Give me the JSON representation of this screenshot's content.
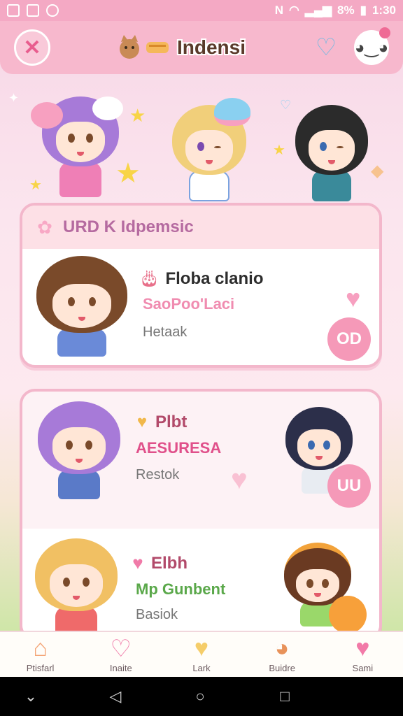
{
  "status_bar": {
    "battery": "8%",
    "time": "1:30"
  },
  "header": {
    "title": "Indensi",
    "close_icon": "close-icon",
    "heart_icon": "heart-outline-icon",
    "mascot_icon": "mascot-icon"
  },
  "featured_card": {
    "section_title": "URD K Idpemsic",
    "title": "Floba clanio",
    "subtitle": "SaoPoo'Laci",
    "meta": "Hetaak",
    "action_label": "OD"
  },
  "list": [
    {
      "title": "Plbt",
      "subtitle": "AESURESA",
      "meta": "Restok",
      "action_label": "UU"
    },
    {
      "title": "Elbh",
      "subtitle": "Mp Gunbent",
      "meta": "Basiok"
    }
  ],
  "bottom_nav": [
    {
      "label": "Ptisfarl",
      "icon": "home-icon"
    },
    {
      "label": "Inaite",
      "icon": "heart-badge-icon"
    },
    {
      "label": "Lark",
      "icon": "yellow-heart-icon"
    },
    {
      "label": "Buidre",
      "icon": "pet-icon"
    },
    {
      "label": "Sami",
      "icon": "pink-heart-icon"
    }
  ],
  "colors": {
    "accent_pink": "#f599b8",
    "header_pink": "#f7b8cd",
    "card_border": "#f3b7cb"
  }
}
